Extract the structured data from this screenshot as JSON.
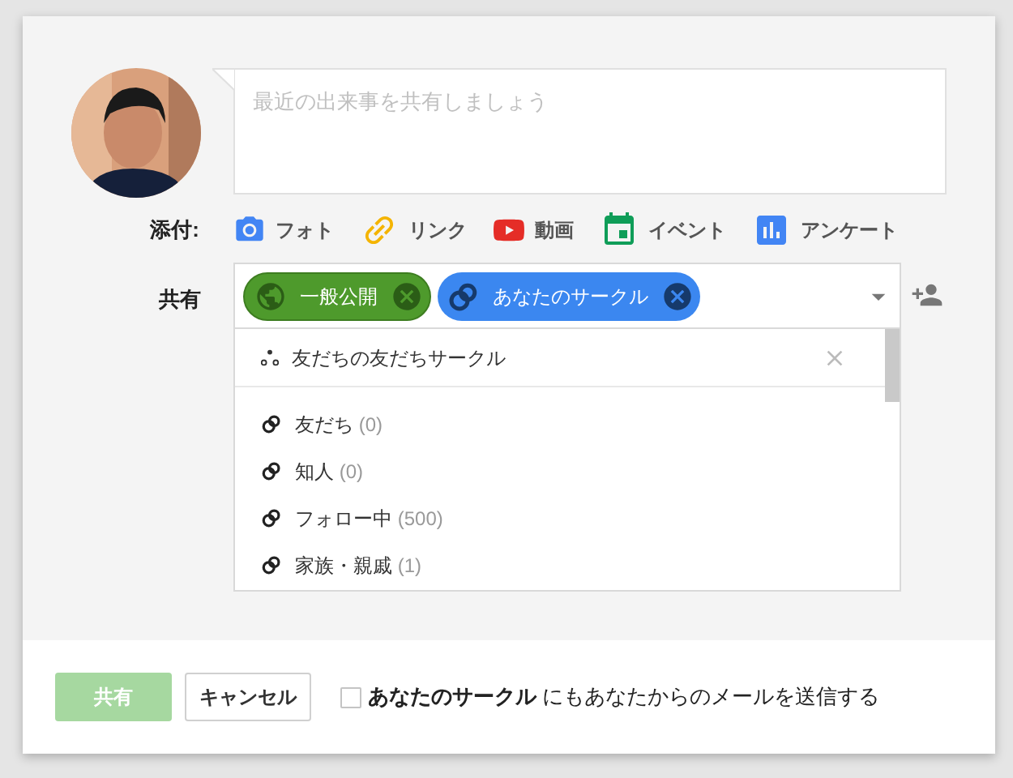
{
  "post": {
    "placeholder": "最近の出来事を共有しましょう"
  },
  "attach": {
    "label": "添付:",
    "items": [
      {
        "label": "フォト"
      },
      {
        "kind": "link",
        "label": "リンク"
      },
      {
        "kind": "video",
        "label": "動画"
      },
      {
        "kind": "event",
        "label": "イベント"
      },
      {
        "kind": "poll",
        "label": "アンケート"
      }
    ]
  },
  "share": {
    "label": "共有",
    "chips": [
      {
        "kind": "public",
        "label": "一般公開"
      },
      {
        "kind": "circles",
        "label": "あなたのサークル"
      }
    ],
    "suggestion": {
      "label": "友だちの友だちサークル"
    },
    "circles": [
      {
        "name": "友だち",
        "count": "(0)"
      },
      {
        "name": "知人",
        "count": "(0)"
      },
      {
        "name": "フォロー中",
        "count": "(500)"
      },
      {
        "name": "家族・親戚",
        "count": "(1)"
      }
    ]
  },
  "footer": {
    "share_button": {
      "label": "共有",
      "disabled": true
    },
    "cancel_button": "キャンセル",
    "notify": {
      "checked": false,
      "text": "**あなたのサークル** にもあなたからのメールを送信する"
    }
  }
}
